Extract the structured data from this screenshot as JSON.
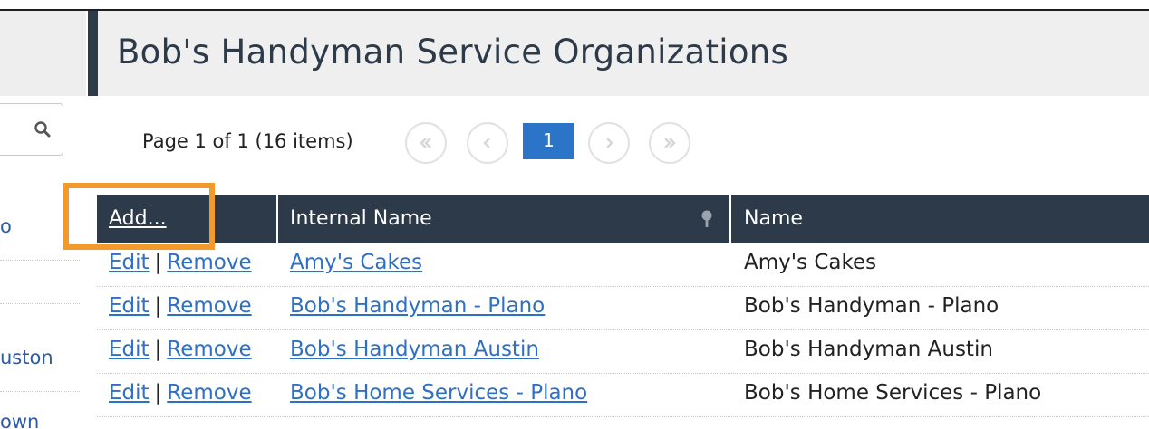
{
  "sidebar": {
    "items": [
      "o",
      "uston",
      "own"
    ]
  },
  "page": {
    "title": "Bob's Handyman Service Organizations"
  },
  "pager": {
    "summary": "Page 1 of 1 (16 items)",
    "current_page": "1"
  },
  "grid": {
    "columns": [
      "Internal Name",
      "Name"
    ],
    "add_label": "Add...",
    "edit_label": "Edit",
    "remove_label": "Remove",
    "separator": "|",
    "rows": [
      {
        "internal_name": "Amy's Cakes",
        "name": "Amy's Cakes"
      },
      {
        "internal_name": "Bob's Handyman - Plano",
        "name": "Bob's Handyman - Plano"
      },
      {
        "internal_name": "Bob's Handyman Austin",
        "name": "Bob's Handyman Austin"
      },
      {
        "internal_name": "Bob's Home Services - Plano",
        "name": "Bob's Home Services - Plano"
      }
    ]
  },
  "colors": {
    "header_dark": "#2c3a4a",
    "link": "#2f6fc4",
    "page_active": "#2b74c8",
    "highlight": "#f39a2c"
  },
  "icons": [
    "search-icon",
    "first-page-icon",
    "prev-page-icon",
    "next-page-icon",
    "last-page-icon",
    "pin-icon"
  ]
}
